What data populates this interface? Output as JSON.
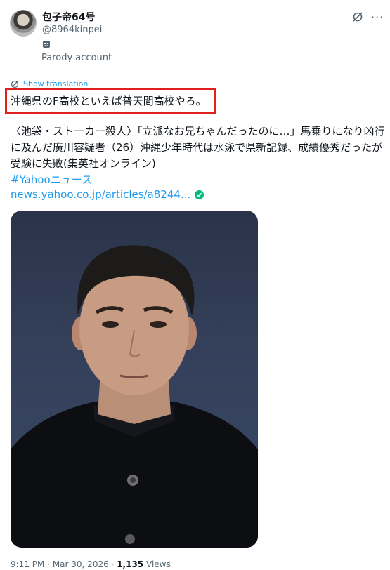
{
  "author": {
    "display_name": "包子帝64号",
    "handle": "@8964kinpei",
    "parody_label": "Parody account"
  },
  "tweet": {
    "translate_label": "Show translation",
    "highlighted_text": "沖縄県のF高校といえば普天間高校やろ。",
    "body_text": "〈池袋・ストーカー殺人〉「立派なお兄ちゃんだったのに…」馬乗りになり凶行に及んだ廣川容疑者（26）沖縄少年時代は水泳で県新記録、成績優秀だったが受験に失敗(集英社オンライン)",
    "hashtag": "#Yahooニュース",
    "link": "news.yahoo.co.jp/articles/a8244...",
    "time": "9:11 PM",
    "date": "Mar 30, 2026",
    "views_count": "1,135",
    "views_label": "Views"
  },
  "icons": {
    "grok": "grok-icon",
    "more": "more-icon",
    "parody": "mask-icon",
    "translate": "translate-icon",
    "verified": "verified-icon"
  },
  "colors": {
    "link": "#1d9bf0",
    "highlight_border": "#e0201b",
    "secondary_text": "#536471",
    "verified": "#00ba7c"
  }
}
